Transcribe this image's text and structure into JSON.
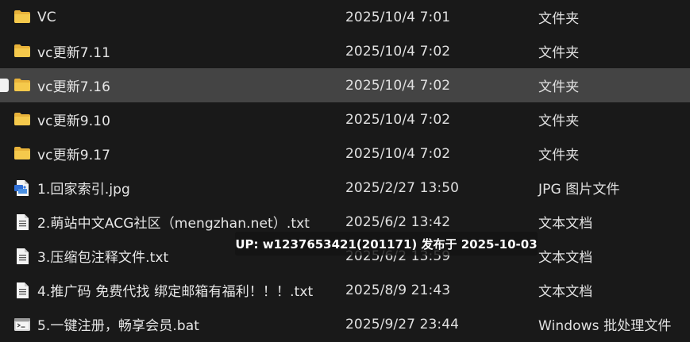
{
  "files": [
    {
      "name": "VC",
      "date": "2025/10/4 7:01",
      "type": "文件夹",
      "icon": "folder-icon",
      "selected": false
    },
    {
      "name": "vc更新7.11",
      "date": "2025/10/4 7:02",
      "type": "文件夹",
      "icon": "folder-icon",
      "selected": false
    },
    {
      "name": "vc更新7.16",
      "date": "2025/10/4 7:02",
      "type": "文件夹",
      "icon": "folder-icon",
      "selected": true
    },
    {
      "name": "vc更新9.10",
      "date": "2025/10/4 7:02",
      "type": "文件夹",
      "icon": "folder-icon",
      "selected": false
    },
    {
      "name": "vc更新9.17",
      "date": "2025/10/4 7:02",
      "type": "文件夹",
      "icon": "folder-icon",
      "selected": false
    },
    {
      "name": "1.回家索引.jpg",
      "date": "2025/2/27 13:50",
      "type": "JPG 图片文件",
      "icon": "image-file-icon",
      "selected": false
    },
    {
      "name": "2.萌站中文ACG社区（mengzhan.net）.txt",
      "date": "2025/6/2 13:42",
      "type": "文本文档",
      "icon": "text-file-icon",
      "selected": false
    },
    {
      "name": "3.压缩包注释文件.txt",
      "date": "2025/6/2 13:59",
      "type": "文本文档",
      "icon": "text-file-icon",
      "selected": false
    },
    {
      "name": "4.推广码 免费代找 绑定邮箱有福利！！！.txt",
      "date": "2025/8/9 21:43",
      "type": "文本文档",
      "icon": "text-file-icon",
      "selected": false
    },
    {
      "name": "5.一键注册，畅享会员.bat",
      "date": "2025/9/27 23:44",
      "type": "Windows 批处理文件",
      "icon": "batch-file-icon",
      "selected": false
    }
  ],
  "watermark": "UP: w1237653421(201171) 发布于 2025-10-03",
  "colors": {
    "background": "#191919",
    "selected_row": "#444444",
    "folder": "#f3c543",
    "text": "#e6e6e6"
  }
}
